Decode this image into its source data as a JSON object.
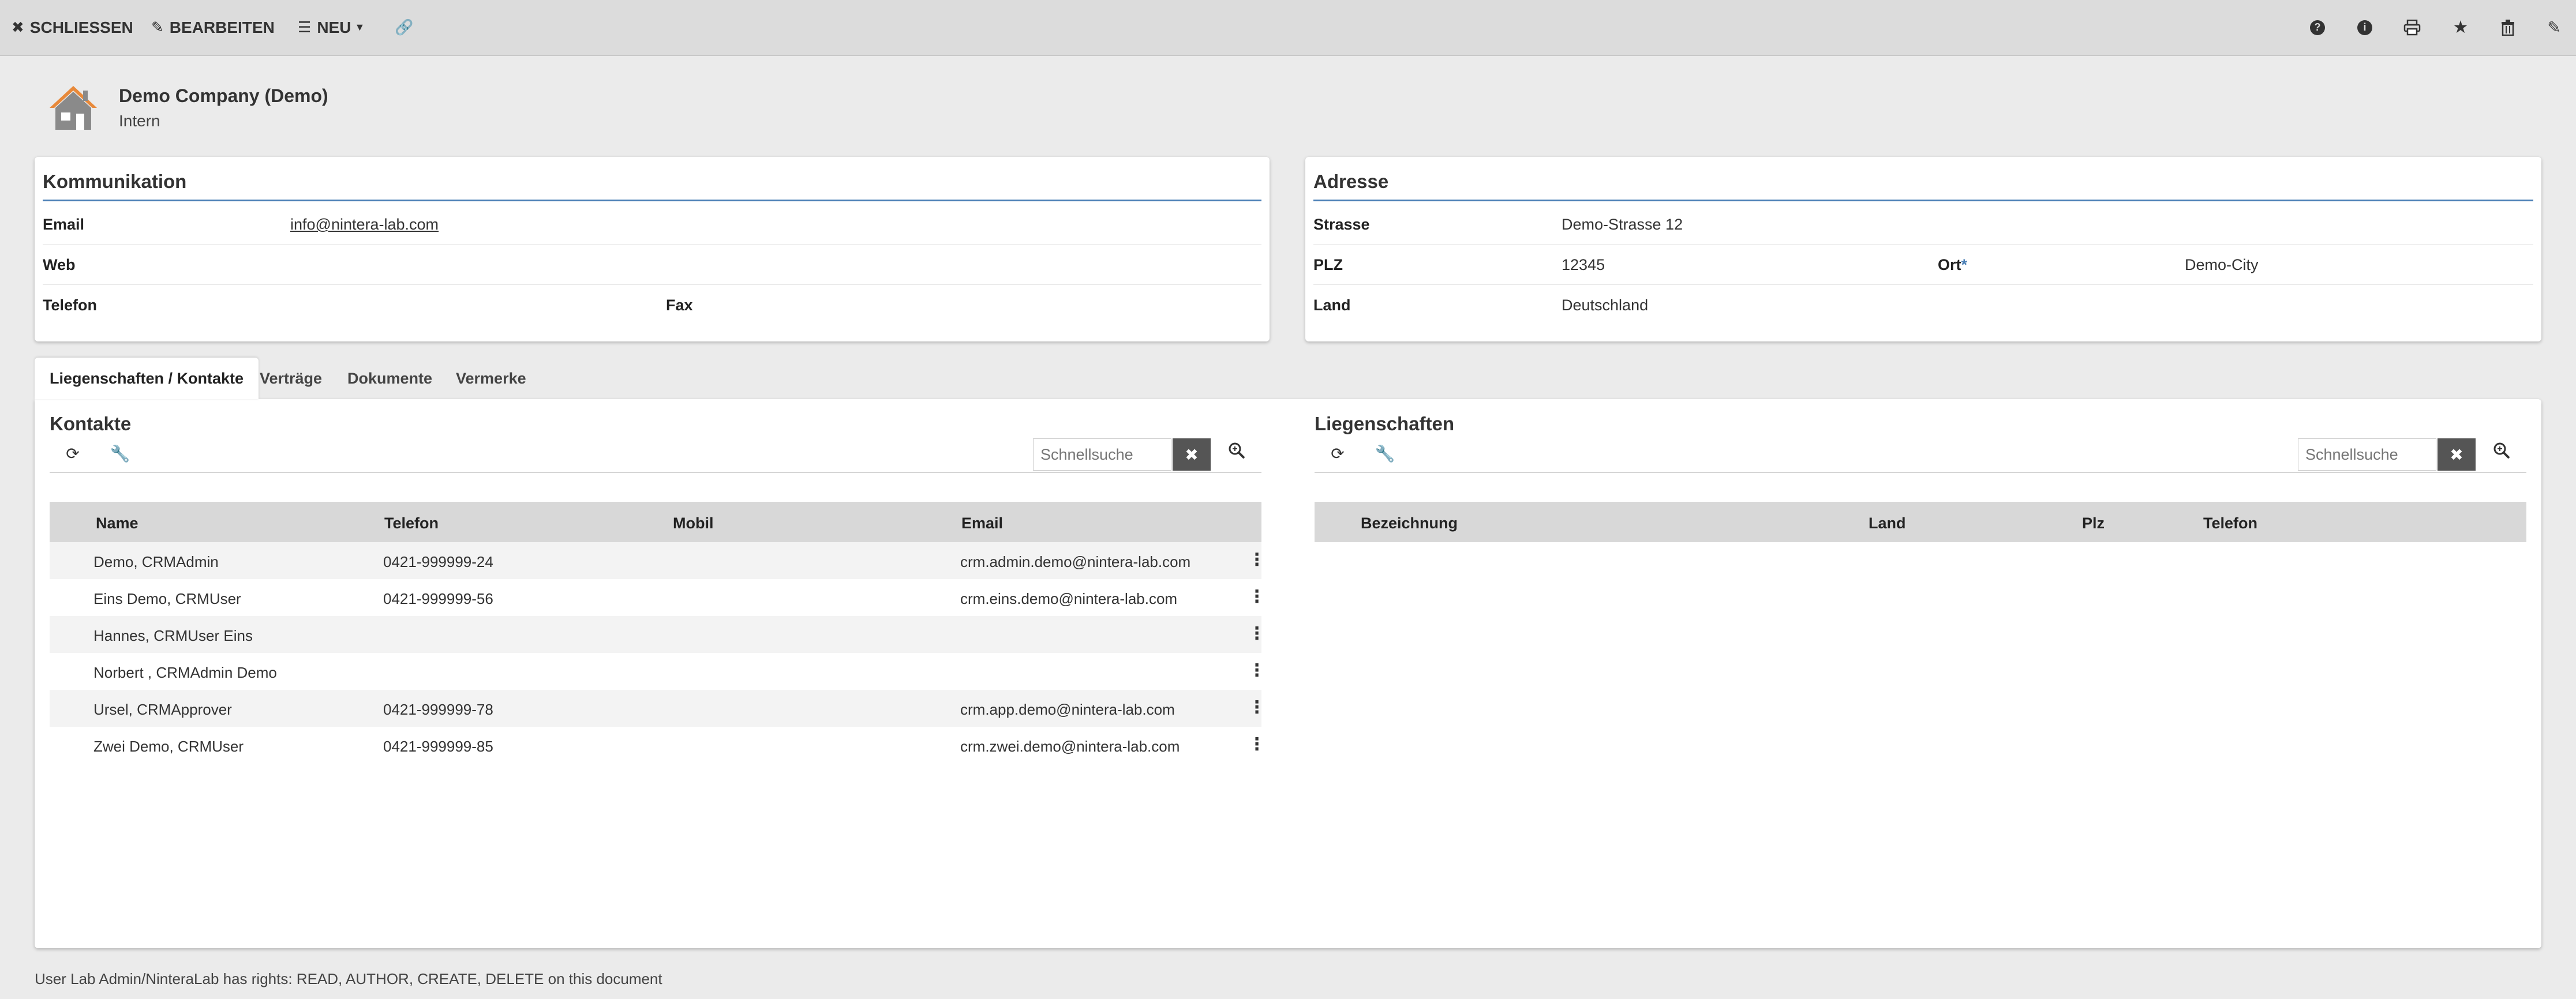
{
  "toolbar": {
    "close": "SCHLIESSEN",
    "edit": "BEARBEITEN",
    "new": "NEU",
    "right_icons": [
      "help-icon",
      "info-icon",
      "print-icon",
      "star-icon",
      "trash-icon",
      "edit-icon"
    ]
  },
  "header": {
    "title": "Demo Company (Demo)",
    "subtitle": "Intern"
  },
  "communication": {
    "title": "Kommunikation",
    "email_label": "Email",
    "email_value": "info@nintera-lab.com",
    "web_label": "Web",
    "web_value": "",
    "phone_label": "Telefon",
    "phone_value": "",
    "fax_label": "Fax",
    "fax_value": ""
  },
  "address": {
    "title": "Adresse",
    "street_label": "Strasse",
    "street_value": "Demo-Strasse 12",
    "zip_label": "PLZ",
    "zip_value": "12345",
    "city_label": "Ort",
    "city_required": "*",
    "city_value": "Demo-City",
    "country_label": "Land",
    "country_value": "Deutschland"
  },
  "tabs": [
    {
      "label": "Liegenschaften / Kontakte",
      "active": true
    },
    {
      "label": "Verträge",
      "active": false
    },
    {
      "label": "Dokumente",
      "active": false
    },
    {
      "label": "Vermerke",
      "active": false
    }
  ],
  "contacts": {
    "title": "Kontakte",
    "search_placeholder": "Schnellsuche",
    "columns": [
      "Name",
      "Telefon",
      "Mobil",
      "Email"
    ],
    "rows": [
      {
        "name": "Demo, CRMAdmin",
        "phone": "0421-999999-24",
        "mobile": "",
        "email": "crm.admin.demo@nintera-lab.com"
      },
      {
        "name": "Eins Demo, CRMUser",
        "phone": "0421-999999-56",
        "mobile": "",
        "email": "crm.eins.demo@nintera-lab.com"
      },
      {
        "name": "Hannes, CRMUser Eins",
        "phone": "",
        "mobile": "",
        "email": ""
      },
      {
        "name": "Norbert , CRMAdmin Demo",
        "phone": "",
        "mobile": "",
        "email": ""
      },
      {
        "name": "Ursel, CRMApprover",
        "phone": "0421-999999-78",
        "mobile": "",
        "email": "crm.app.demo@nintera-lab.com"
      },
      {
        "name": "Zwei Demo, CRMUser",
        "phone": "0421-999999-85",
        "mobile": "",
        "email": "crm.zwei.demo@nintera-lab.com"
      }
    ]
  },
  "properties": {
    "title": "Liegenschaften",
    "search_placeholder": "Schnellsuche",
    "columns": [
      "Bezeichnung",
      "Land",
      "Plz",
      "Telefon"
    ],
    "rows": []
  },
  "footer": {
    "rights_text": "User Lab Admin/NinteraLab has rights: READ, AUTHOR, CREATE, DELETE on this document"
  },
  "colors": {
    "accent_rule": "#4a7fb5",
    "house_roof": "#e8893a",
    "house_body": "#8a8a8a"
  }
}
